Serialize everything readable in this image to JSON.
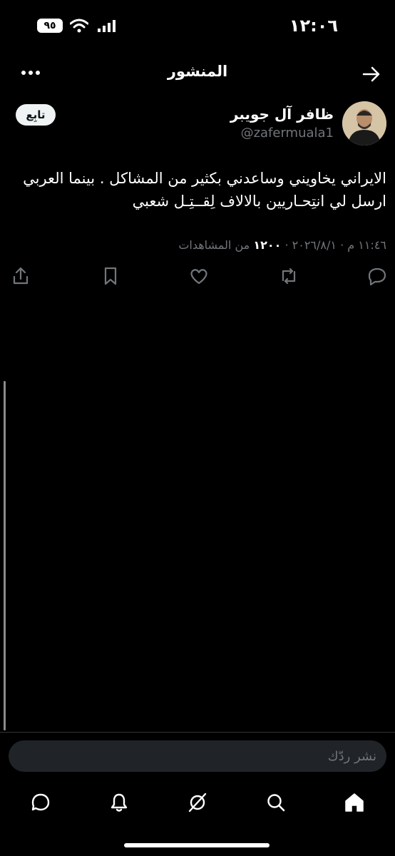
{
  "status_bar": {
    "time": "١٢:٠٦",
    "battery": "٩٥"
  },
  "header": {
    "title": "المنشور"
  },
  "post": {
    "author_name": "ظافر آل جويبر",
    "author_handle": "@zafermuala1",
    "follow_label": "تابِع",
    "text": "الايراني يخاويني وساعدني بكثير من المشاكل . بينما العربي ارسل لي انتِحـاريين بالالاف لِقــتِـل شعبي",
    "timestamp": "١١:٤٦ م · ٢٠٢٦/٨/١ ·",
    "views_count": "١٢٠٠",
    "views_label": "من المشاهدات"
  },
  "reply": {
    "placeholder": "نشر ردّك"
  },
  "icons": [
    "wifi-icon",
    "signal-icon",
    "more-icon",
    "back-icon",
    "reply-icon",
    "repost-icon",
    "like-icon",
    "bookmark-icon",
    "share-icon",
    "home-icon",
    "search-icon",
    "grok-icon",
    "notifications-icon",
    "messages-icon"
  ]
}
